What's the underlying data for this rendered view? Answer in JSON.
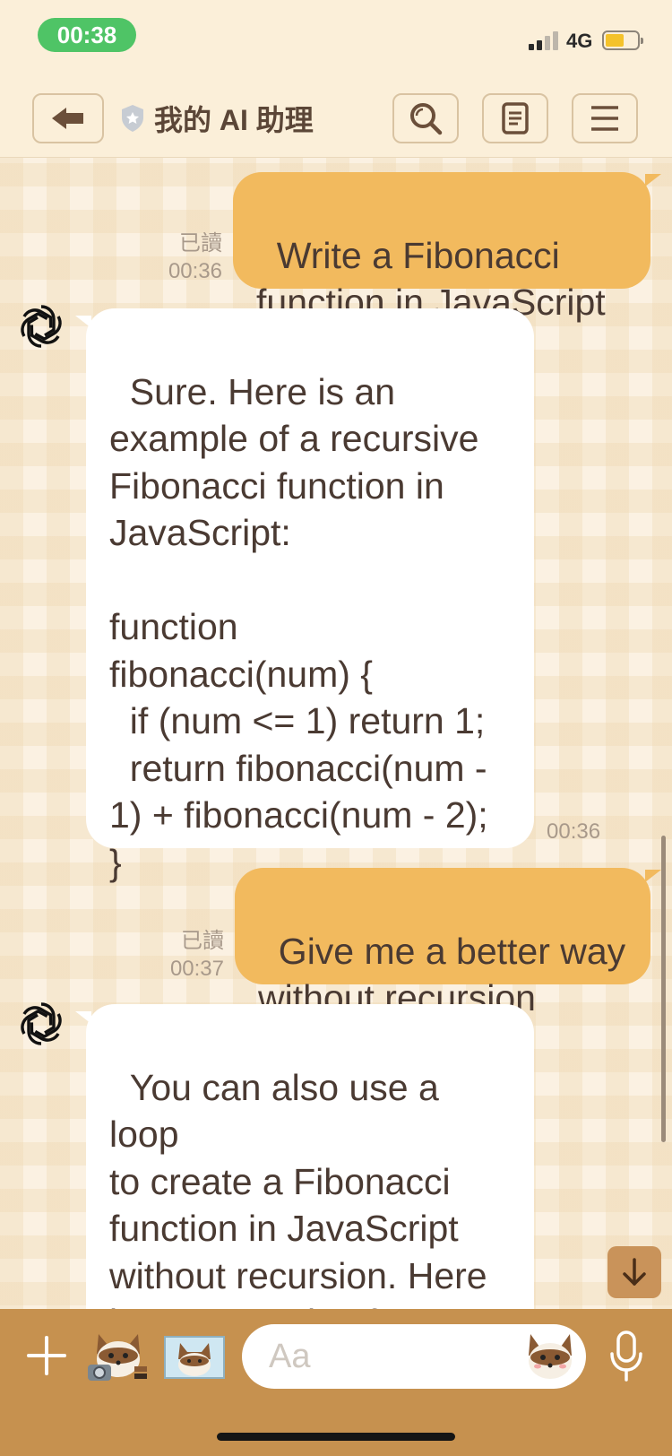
{
  "status_bar": {
    "time": "00:38",
    "network": "4G",
    "battery_level": 0.6,
    "signal_bars": 2
  },
  "header": {
    "title": "我的 AI 助理",
    "back_icon": "arrow-left-icon",
    "search_icon": "search-icon",
    "notes_icon": "notes-icon",
    "menu_icon": "menu-icon"
  },
  "messages": [
    {
      "direction": "outgoing",
      "text": "Write a Fibonacci\nfunction in JavaScript",
      "read_label": "已讀",
      "time": "00:36"
    },
    {
      "direction": "incoming",
      "avatar_icon": "openai-logo-icon",
      "text": "Sure. Here is an\nexample of a recursive\nFibonacci function in\nJavaScript:\n\nfunction\nfibonacci(num) {\n  if (num <= 1) return 1;\n  return fibonacci(num -\n1) + fibonacci(num - 2);\n}",
      "time": "00:36"
    },
    {
      "direction": "outgoing",
      "text": "Give me a better way\nwithout recursion",
      "read_label": "已讀",
      "time": "00:37"
    },
    {
      "direction": "incoming",
      "avatar_icon": "openai-logo-icon",
      "text": "You can also use a loop\nto create a Fibonacci\nfunction in JavaScript\nwithout recursion. Here\nis an example of a\nloop-based approach:"
    }
  ],
  "input_bar": {
    "placeholder": "Aa",
    "value": ""
  },
  "colors": {
    "outgoing_bubble": "#f2ba5e",
    "incoming_bubble": "#ffffff",
    "input_bar": "#c6914f",
    "header": "#fbefd9",
    "status_pill": "#4fc466"
  }
}
